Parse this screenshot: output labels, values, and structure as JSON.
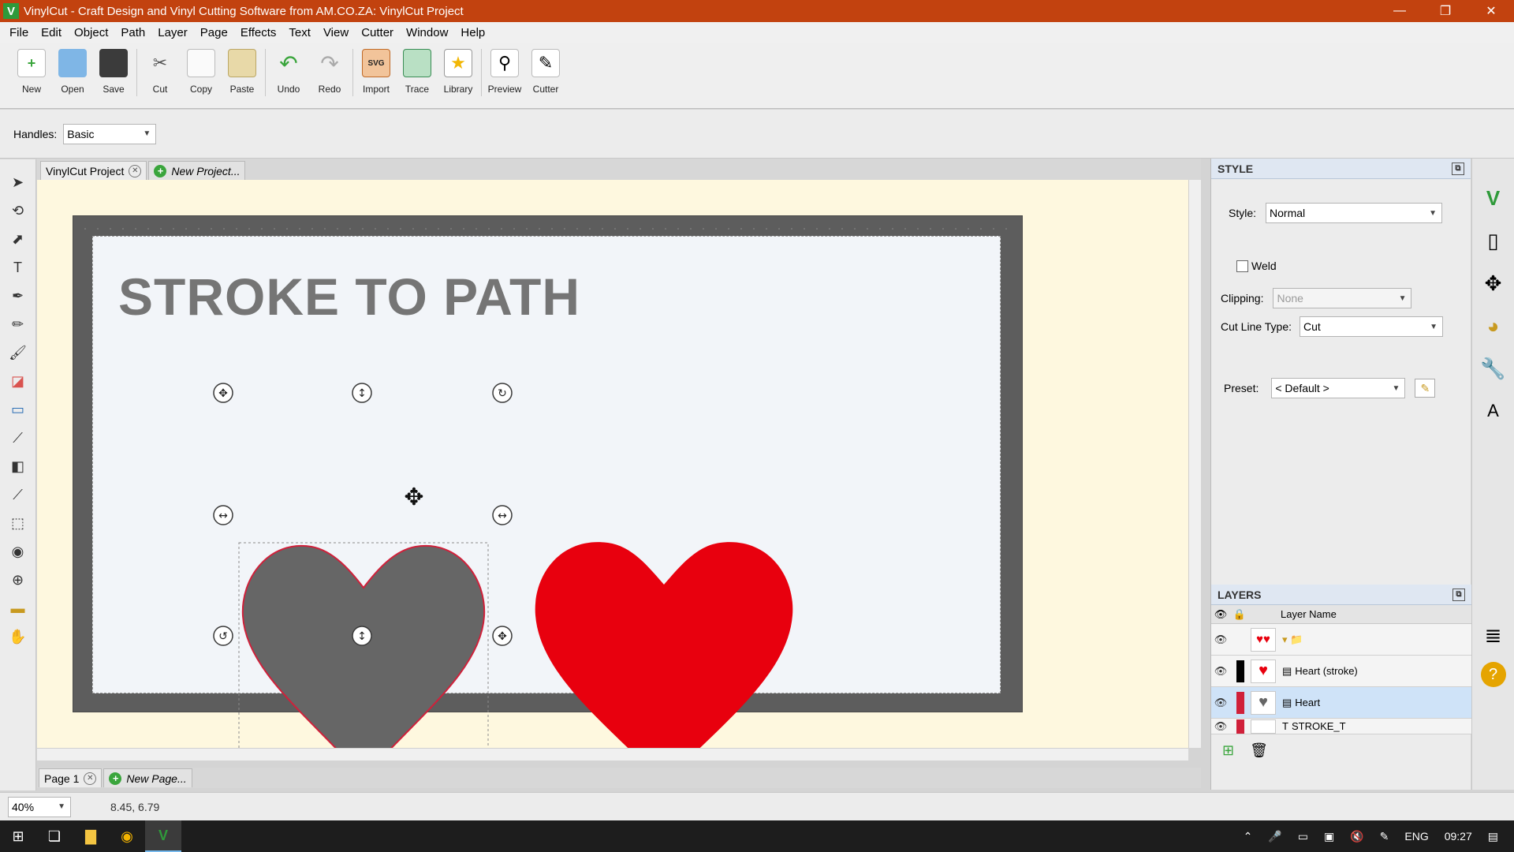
{
  "window": {
    "app_icon": "V",
    "title": "VinylCut - Craft Design and Vinyl Cutting Software from AM.CO.ZA: VinylCut Project",
    "minimize": "—",
    "restore": "❐",
    "close": "✕"
  },
  "menu": [
    "File",
    "Edit",
    "Object",
    "Path",
    "Layer",
    "Page",
    "Effects",
    "Text",
    "View",
    "Cutter",
    "Window",
    "Help"
  ],
  "toolbar": [
    {
      "label": "New",
      "icon": "new-icon"
    },
    {
      "label": "Open",
      "icon": "open-icon"
    },
    {
      "label": "Save",
      "icon": "save-icon"
    },
    {
      "label": "Cut",
      "icon": "scissors-icon"
    },
    {
      "label": "Copy",
      "icon": "copy-icon"
    },
    {
      "label": "Paste",
      "icon": "paste-icon"
    },
    {
      "label": "Undo",
      "icon": "undo-icon"
    },
    {
      "label": "Redo",
      "icon": "redo-icon"
    },
    {
      "label": "Import",
      "icon": "import-svg-icon",
      "badge": "SVG"
    },
    {
      "label": "Trace",
      "icon": "trace-icon"
    },
    {
      "label": "Library",
      "icon": "star-icon"
    },
    {
      "label": "Preview",
      "icon": "magnifier-icon"
    },
    {
      "label": "Cutter",
      "icon": "cutter-icon"
    }
  ],
  "handles": {
    "label": "Handles:",
    "value": "Basic"
  },
  "doc_tabs": {
    "active": "VinylCut Project",
    "new": "New Project..."
  },
  "canvas": {
    "title_text": "STROKE TO PATH",
    "colors": {
      "mat": "#5d5d5d",
      "page": "#f2f5f9",
      "gray_heart": "#666666",
      "red_heart": "#e8000e",
      "stroke": "#d0203a"
    }
  },
  "page_tabs": {
    "active": "Page 1",
    "new": "New Page..."
  },
  "status": {
    "zoom": "40%",
    "coords": "8.45, 6.79"
  },
  "style_panel": {
    "title": "STYLE",
    "style_label": "Style:",
    "style_value": "Normal",
    "weld_label": "Weld",
    "clipping_label": "Clipping:",
    "clipping_value": "None",
    "cutline_label": "Cut Line Type:",
    "cutline_value": "Cut",
    "preset_label": "Preset:",
    "preset_value": "< Default >"
  },
  "layers_panel": {
    "title": "LAYERS",
    "column": "Layer Name",
    "rows": [
      {
        "name": "",
        "type": "group"
      },
      {
        "name": "Heart (stroke)",
        "type": "object",
        "color": "#000000"
      },
      {
        "name": "Heart",
        "type": "object",
        "color": "#d0203a",
        "selected": true
      },
      {
        "name": "STROKE_T",
        "type": "text",
        "color": "#d0203a"
      }
    ]
  },
  "taskbar": {
    "lang": "ENG",
    "time": "09:27"
  }
}
